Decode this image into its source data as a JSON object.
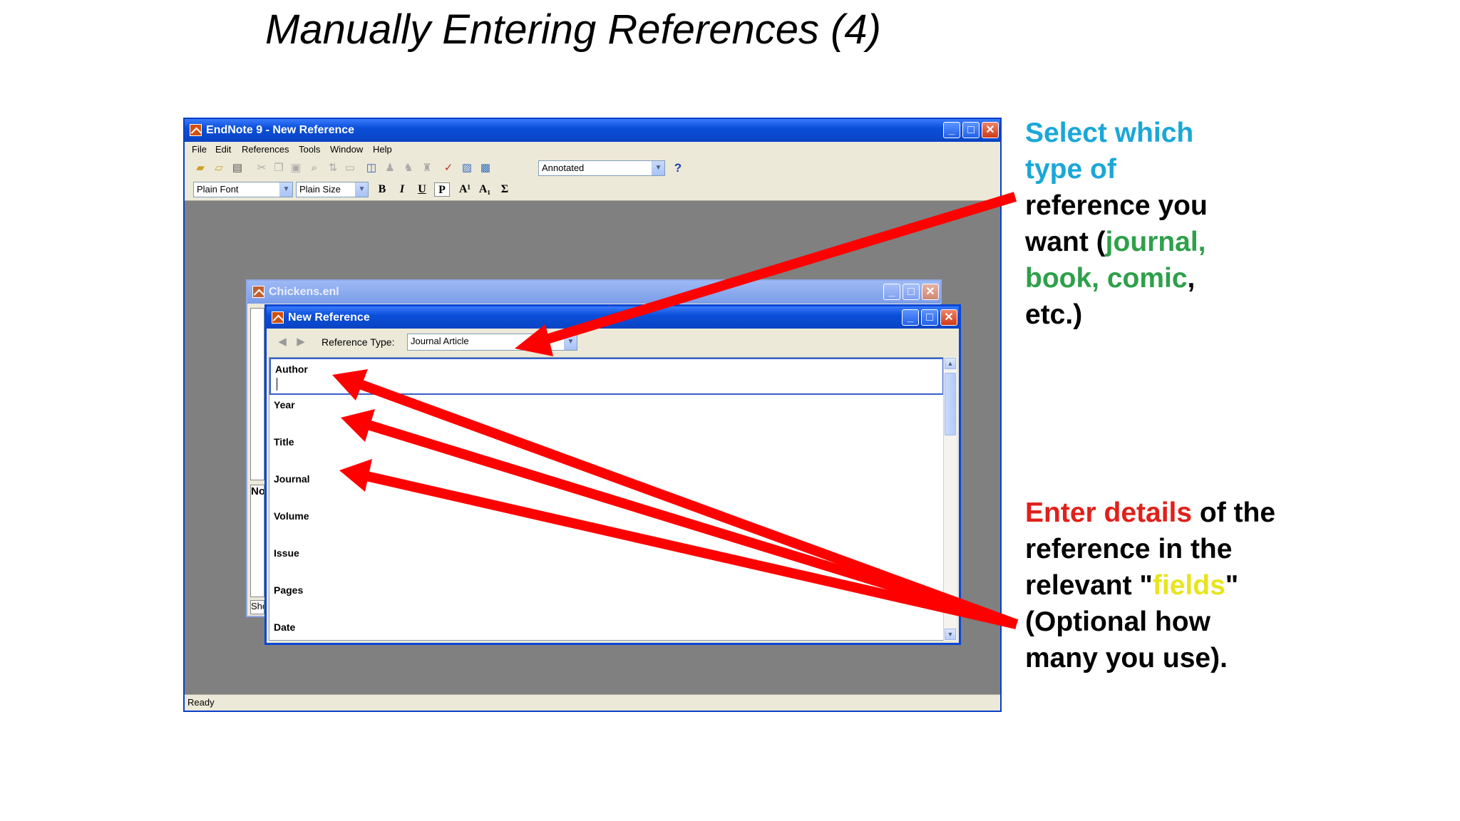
{
  "slide": {
    "title": "Manually Entering References (4)"
  },
  "app_window": {
    "title": "EndNote 9 - New Reference",
    "menu": [
      "File",
      "Edit",
      "References",
      "Tools",
      "Window",
      "Help"
    ],
    "style_dropdown": "Annotated",
    "help_label": "?",
    "font_dropdown": "Plain Font",
    "size_dropdown": "Plain Size",
    "format_buttons": [
      "B",
      "I",
      "U",
      "P",
      "A¹",
      "A₁",
      "Σ"
    ],
    "status": "Ready"
  },
  "library_window": {
    "title": "Chickens.enl",
    "pane_mid_text": "No",
    "pane_bottom_text": "Sho"
  },
  "new_reference_window": {
    "title": "New Reference",
    "reference_type_label": "Reference Type:",
    "reference_type_value": "Journal Article",
    "fields": [
      "Author",
      "Year",
      "Title",
      "Journal",
      "Volume",
      "Issue",
      "Pages",
      "Date"
    ]
  },
  "annotation_top": {
    "line1": "Select which",
    "line2": "type of",
    "line3": "reference you",
    "line4_prefix": "want (",
    "line4_highlight": "journal,",
    "line5_highlight": "book, comic",
    "line5_suffix": ",",
    "line6": "etc.)"
  },
  "annotation_bottom": {
    "line1_highlight": "Enter details",
    "line1_suffix": " of the",
    "line2": "reference in the",
    "line3_prefix": "relevant \"",
    "line3_highlight": "fields",
    "line3_suffix": "\"",
    "line4": "(Optional how",
    "line5": "many you use)."
  },
  "colors": {
    "arrow": "#ff0000",
    "blue_text": "#1aa7d8",
    "green_text": "#2ea04a",
    "red_text": "#e0201a",
    "yellow_text": "#e7e51c",
    "titlebar": "#0a4fd9",
    "workspace": "#808080"
  },
  "icons": [
    "endnote-app-icon",
    "new-icon",
    "open-icon",
    "print-icon",
    "cut-icon",
    "copy-icon",
    "paste-icon",
    "find-icon",
    "sort-icon",
    "help-icon",
    "minimize-icon",
    "maximize-icon",
    "close-icon",
    "scroll-up-icon",
    "scroll-down-icon"
  ]
}
